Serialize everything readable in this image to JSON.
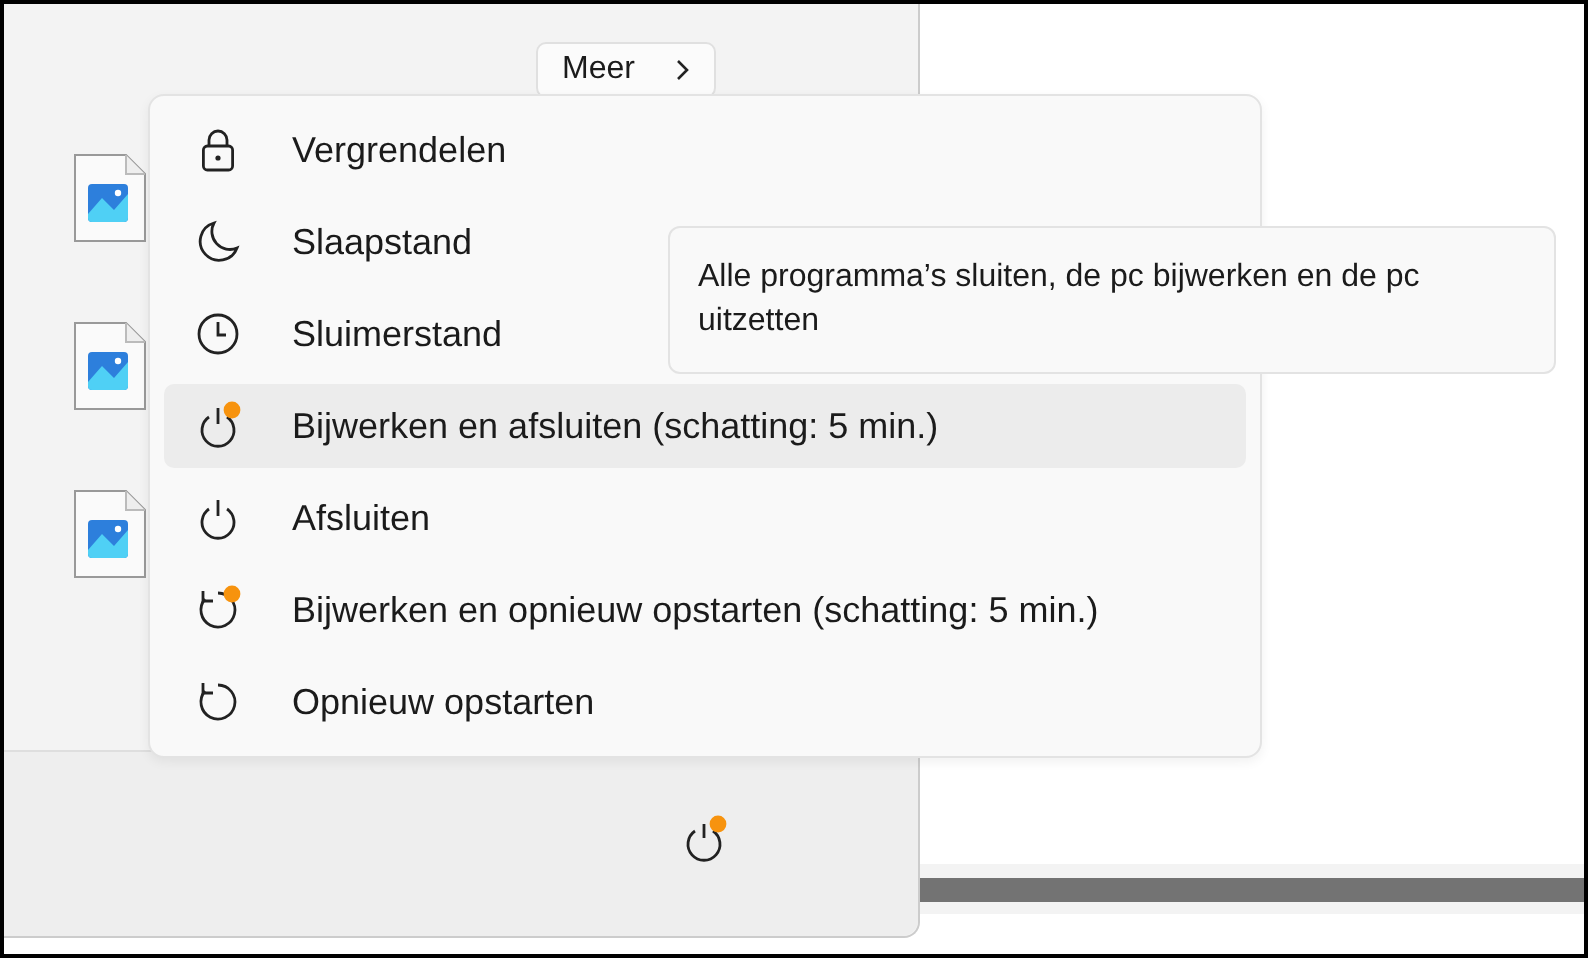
{
  "more_button": {
    "label": "Meer"
  },
  "power_menu": {
    "items": [
      {
        "kind": "lock",
        "label": "Vergrendelen",
        "update_pending": false,
        "hovered": false
      },
      {
        "kind": "moon",
        "label": "Slaapstand",
        "update_pending": false,
        "hovered": false
      },
      {
        "kind": "clock",
        "label": "Sluimerstand",
        "update_pending": false,
        "hovered": false
      },
      {
        "kind": "power",
        "label": "Bijwerken en afsluiten (schatting: 5 min.)",
        "update_pending": true,
        "hovered": true
      },
      {
        "kind": "power",
        "label": "Afsluiten",
        "update_pending": false,
        "hovered": false
      },
      {
        "kind": "restart",
        "label": "Bijwerken en opnieuw opstarten (schatting: 5 min.)",
        "update_pending": true,
        "hovered": false
      },
      {
        "kind": "restart",
        "label": "Opnieuw opstarten",
        "update_pending": false,
        "hovered": false
      }
    ]
  },
  "tooltip": {
    "text": "Alle programma’s sluiten, de pc bijwerken en de pc uitzetten"
  },
  "power_button": {
    "update_pending": true
  }
}
